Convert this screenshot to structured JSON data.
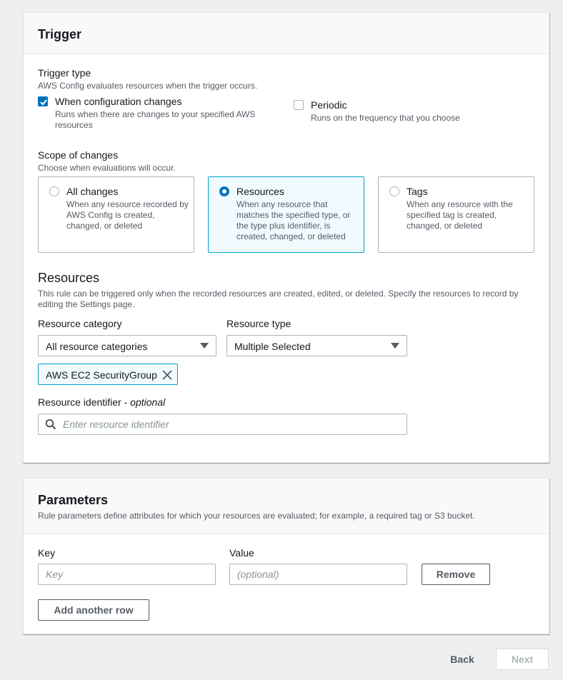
{
  "trigger": {
    "title": "Trigger",
    "trigger_type": {
      "label": "Trigger type",
      "description": "AWS Config evaluates resources when the trigger occurs.",
      "options": [
        {
          "label": "When configuration changes",
          "description": "Runs when there are changes to your specified AWS resources",
          "checked": true
        },
        {
          "label": "Periodic",
          "description": "Runs on the frequency that you choose",
          "checked": false
        }
      ]
    },
    "scope": {
      "label": "Scope of changes",
      "description": "Choose when evaluations will occur.",
      "options": [
        {
          "label": "All changes",
          "description": "When any resource recorded by AWS Config is created, changed, or deleted",
          "selected": false
        },
        {
          "label": "Resources",
          "description": "When any resource that matches the specified type, or the type plus identifier, is created, changed, or deleted",
          "selected": true
        },
        {
          "label": "Tags",
          "description": "When any resource with the specified tag is created, changed, or deleted",
          "selected": false
        }
      ]
    },
    "resources": {
      "title": "Resources",
      "description": "This rule can be triggered only when the recorded resources are created, edited, or deleted. Specify the resources to record by editing the Settings page.",
      "category": {
        "label": "Resource category",
        "value": "All resource categories"
      },
      "type": {
        "label": "Resource type",
        "value": "Multiple Selected"
      },
      "tokens": [
        "AWS EC2 SecurityGroup"
      ],
      "identifier": {
        "label": "Resource identifier - ",
        "label_optional": "optional",
        "placeholder": "Enter resource identifier",
        "value": ""
      }
    }
  },
  "parameters": {
    "title": "Parameters",
    "description": "Rule parameters define attributes for which your resources are evaluated; for example, a required tag or S3 bucket.",
    "key_label": "Key",
    "value_label": "Value",
    "rows": [
      {
        "key_placeholder": "Key",
        "value_placeholder": "(optional)",
        "key": "",
        "value": ""
      }
    ],
    "remove_label": "Remove",
    "add_row_label": "Add another row"
  },
  "footer": {
    "back_label": "Back",
    "next_label": "Next"
  },
  "colors": {
    "accent": "#0073bb",
    "selected_border": "#00a1c9",
    "selected_bg": "#f1faff"
  }
}
